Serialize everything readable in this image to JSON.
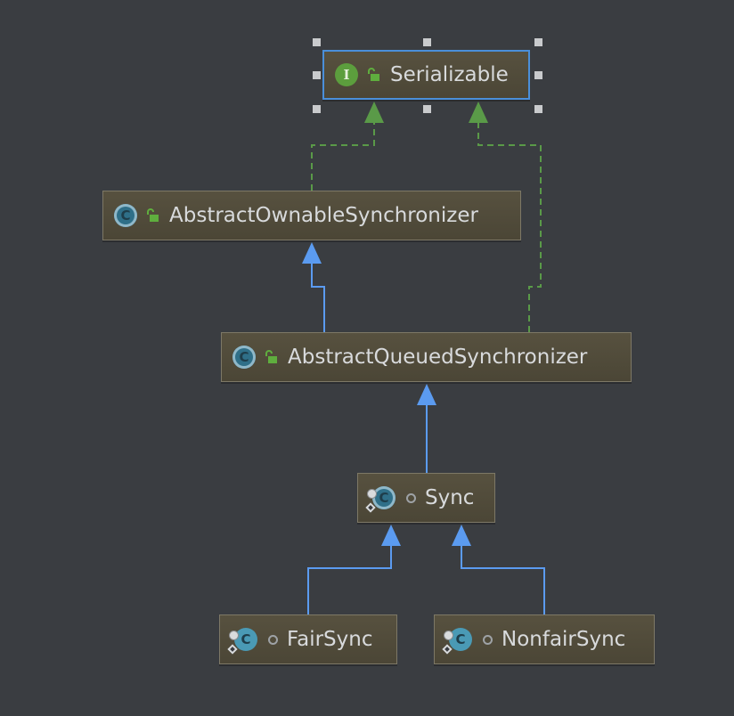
{
  "diagram": {
    "nodes": [
      {
        "id": "serializable",
        "label": "Serializable",
        "kind": "interface",
        "icon": "interface-icon",
        "visibility": "public",
        "selected": true
      },
      {
        "id": "aos",
        "label": "AbstractOwnableSynchronizer",
        "kind": "abstract-class",
        "icon": "abstract-class-icon",
        "visibility": "public"
      },
      {
        "id": "aqs",
        "label": "AbstractQueuedSynchronizer",
        "kind": "abstract-class",
        "icon": "abstract-class-icon",
        "visibility": "public"
      },
      {
        "id": "sync",
        "label": "Sync",
        "kind": "static-abstract-class",
        "icon": "static-abstract-class-icon",
        "visibility": "package-private"
      },
      {
        "id": "fairsync",
        "label": "FairSync",
        "kind": "static-final-class",
        "icon": "static-final-class-icon",
        "visibility": "package-private"
      },
      {
        "id": "nonfairsync",
        "label": "NonfairSync",
        "kind": "static-final-class",
        "icon": "static-final-class-icon",
        "visibility": "package-private"
      }
    ],
    "edges": [
      {
        "from": "aos",
        "to": "serializable",
        "type": "implements"
      },
      {
        "from": "aqs",
        "to": "serializable",
        "type": "implements"
      },
      {
        "from": "aqs",
        "to": "aos",
        "type": "extends"
      },
      {
        "from": "sync",
        "to": "aqs",
        "type": "extends"
      },
      {
        "from": "fairsync",
        "to": "sync",
        "type": "extends"
      },
      {
        "from": "nonfairsync",
        "to": "sync",
        "type": "extends"
      }
    ],
    "colors": {
      "background": "#3a3d41",
      "extends_edge": "#5b9bf0",
      "implements_edge": "#5a9a48",
      "selection": "#4a8fd9"
    }
  }
}
